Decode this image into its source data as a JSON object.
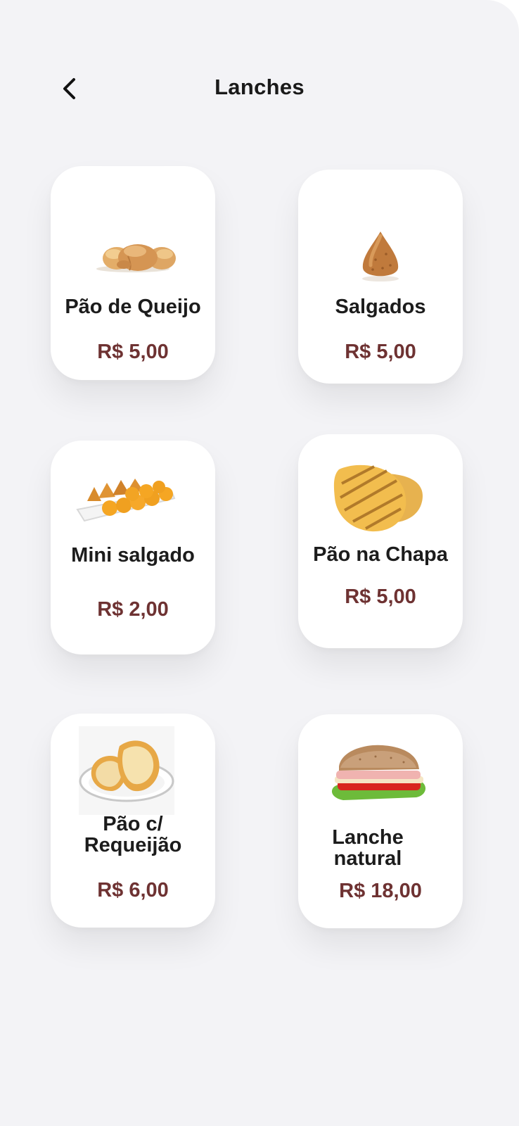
{
  "header": {
    "title": "Lanches",
    "back_icon": "chevron-left-icon"
  },
  "products": [
    {
      "name": "Pão de Queijo",
      "price": "R$ 5,00",
      "icon": "cheese-bread-icon"
    },
    {
      "name": "Salgados",
      "price": "R$ 5,00",
      "icon": "coxinha-icon"
    },
    {
      "name": "Mini salgado",
      "price": "R$ 2,00",
      "icon": "mini-savory-tray-icon"
    },
    {
      "name": "Pão na Chapa",
      "price": "R$ 5,00",
      "icon": "grilled-bread-icon"
    },
    {
      "name": "Pão c/ Requeijão",
      "name_line1": "Pão c/",
      "name_line2": "Requeijão",
      "price": "R$ 6,00",
      "icon": "bread-cream-cheese-plate-icon"
    },
    {
      "name": "Lanche natural",
      "name_line1": "Lanche",
      "name_line2": "natural",
      "price": "R$ 18,00",
      "icon": "sandwich-icon"
    }
  ],
  "colors": {
    "background": "#f3f3f6",
    "card": "#ffffff",
    "price": "#6e3232",
    "text": "#1c1c1c"
  }
}
